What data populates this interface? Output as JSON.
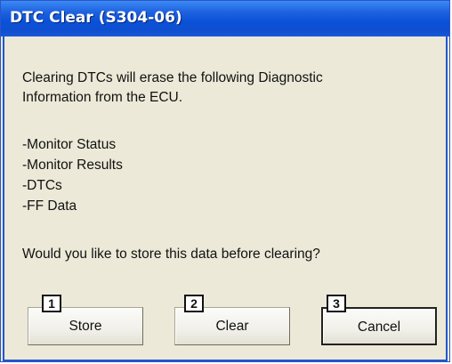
{
  "dialog": {
    "title": "DTC Clear (S304-06)",
    "message_line1": "Clearing DTCs will erase the following Diagnostic",
    "message_line2": "Information from the ECU.",
    "items": [
      "-Monitor Status",
      "-Monitor Results",
      "-DTCs",
      "-FF Data"
    ],
    "question": "Would you like to store this data before clearing?"
  },
  "buttons": [
    {
      "number": "1",
      "label": "Store"
    },
    {
      "number": "2",
      "label": "Clear"
    },
    {
      "number": "3",
      "label": "Cancel"
    }
  ],
  "colors": {
    "title_bar": "#0a50d8",
    "dialog_face": "#ece9d8"
  }
}
